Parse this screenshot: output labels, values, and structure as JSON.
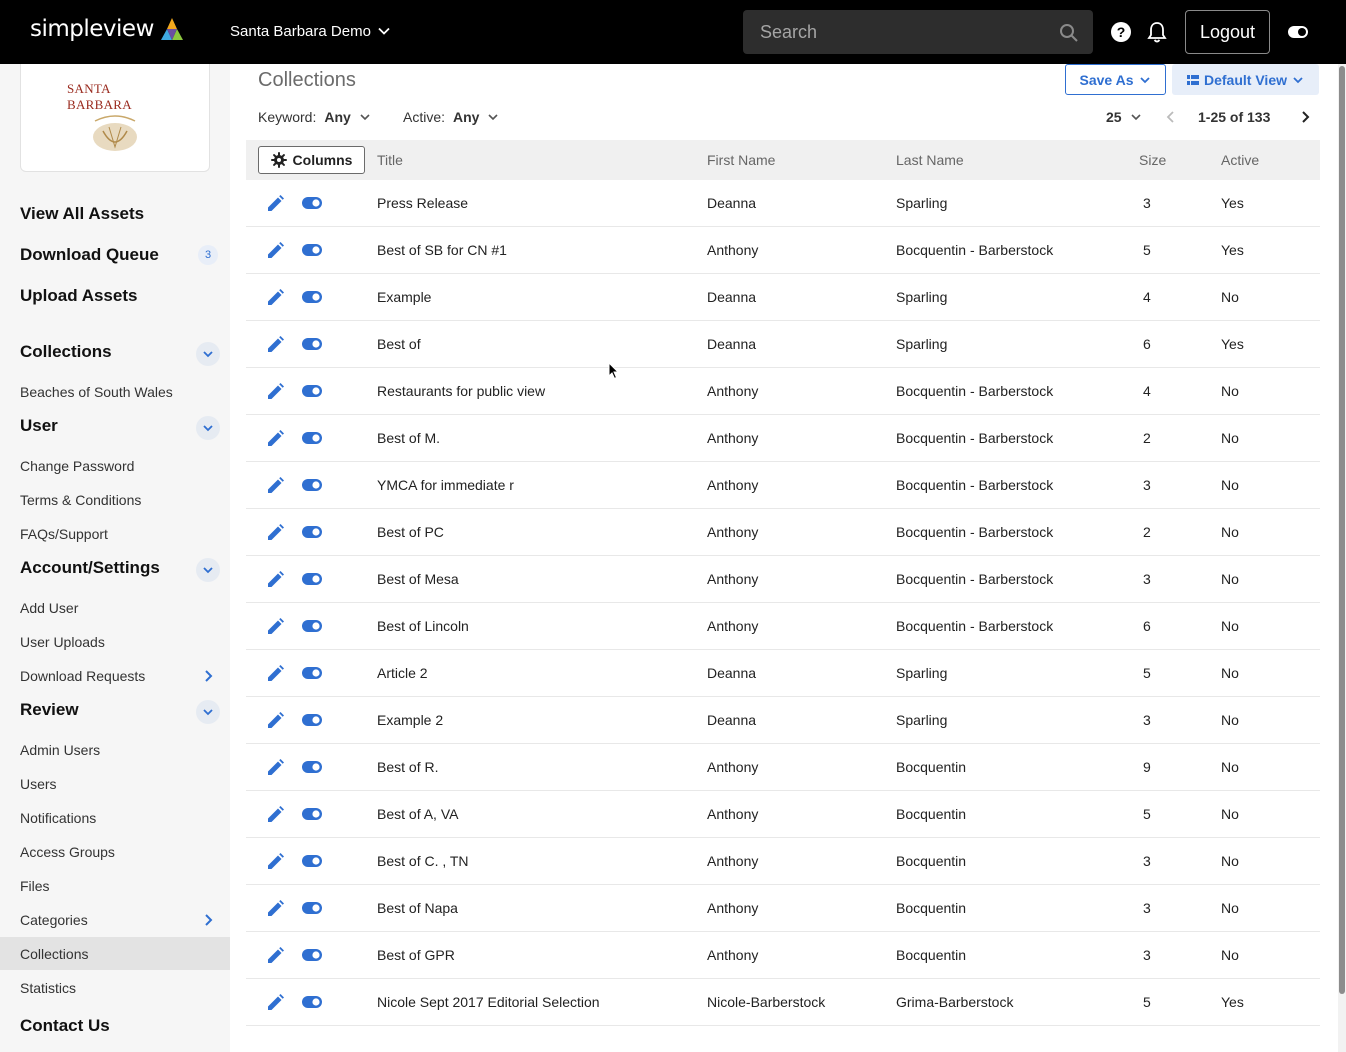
{
  "header": {
    "logo_text": "simpleview",
    "site_name": "Santa Barbara Demo",
    "search_placeholder": "Search",
    "logout_label": "Logout"
  },
  "sidebar": {
    "brand_text": "SANTA BARBARA",
    "main_links": [
      {
        "label": "View All Assets"
      },
      {
        "label": "Download Queue",
        "badge": "3"
      },
      {
        "label": "Upload Assets"
      }
    ],
    "sections": [
      {
        "title": "Collections",
        "items": [
          "Beaches of South Wales"
        ]
      },
      {
        "title": "User",
        "items": [
          "Change Password",
          "Terms & Conditions",
          "FAQs/Support"
        ]
      },
      {
        "title": "Account/Settings",
        "items": [
          "Add User",
          "User Uploads",
          "Download Requests"
        ]
      },
      {
        "title": "Review",
        "items": [
          "Admin Users",
          "Users",
          "Notifications",
          "Access Groups",
          "Files",
          "Categories",
          "Collections",
          "Statistics"
        ]
      }
    ],
    "contact": "Contact Us",
    "active_item": "Collections"
  },
  "main": {
    "title": "Collections",
    "save_as_label": "Save As",
    "default_view_label": "Default View",
    "filters": [
      {
        "label": "Keyword:",
        "value": "Any"
      },
      {
        "label": "Active:",
        "value": "Any"
      }
    ],
    "page_size": "25",
    "range": "1-25 of 133",
    "columns_label": "Columns",
    "headers": [
      "Title",
      "First Name",
      "Last Name",
      "Size",
      "Active"
    ],
    "rows": [
      [
        "Press Release",
        "Deanna",
        "Sparling",
        "3",
        "Yes"
      ],
      [
        "Best of SB for CN #1",
        "Anthony",
        "Bocquentin - Barberstock",
        "5",
        "Yes"
      ],
      [
        "Example",
        "Deanna",
        "Sparling",
        "4",
        "No"
      ],
      [
        "Best of",
        "Deanna",
        "Sparling",
        "6",
        "Yes"
      ],
      [
        "Restaurants for public view",
        "Anthony",
        "Bocquentin - Barberstock",
        "4",
        "No"
      ],
      [
        "Best of M.",
        "Anthony",
        "Bocquentin - Barberstock",
        "2",
        "No"
      ],
      [
        "YMCA for immediate r",
        "Anthony",
        "Bocquentin - Barberstock",
        "3",
        "No"
      ],
      [
        "Best of PC",
        "Anthony",
        "Bocquentin - Barberstock",
        "2",
        "No"
      ],
      [
        "Best of Mesa",
        "Anthony",
        "Bocquentin - Barberstock",
        "3",
        "No"
      ],
      [
        "Best of Lincoln",
        "Anthony",
        "Bocquentin - Barberstock",
        "6",
        "No"
      ],
      [
        "Article 2",
        "Deanna",
        "Sparling",
        "5",
        "No"
      ],
      [
        "Example 2",
        "Deanna",
        "Sparling",
        "3",
        "No"
      ],
      [
        "Best of R.",
        "Anthony",
        "Bocquentin",
        "9",
        "No"
      ],
      [
        "Best of A, VA",
        "Anthony",
        "Bocquentin",
        "5",
        "No"
      ],
      [
        "Best of C. , TN",
        "Anthony",
        "Bocquentin",
        "3",
        "No"
      ],
      [
        "Best of Napa",
        "Anthony",
        "Bocquentin",
        "3",
        "No"
      ],
      [
        "Best of GPR",
        "Anthony",
        "Bocquentin",
        "3",
        "No"
      ],
      [
        "Nicole Sept 2017 Editorial Selection",
        "Nicole-Barberstock",
        "Grima-Barberstock",
        "5",
        "Yes"
      ]
    ]
  },
  "colors": {
    "accent": "#2f6fd1",
    "topbar": "#000000",
    "sidebar_bg": "#f6f6f6"
  },
  "icons": [
    "search-icon",
    "help-icon",
    "bell-icon",
    "theme-toggle-icon",
    "chevron-down-icon",
    "gear-icon",
    "edit-pencil-icon",
    "toggle-icon",
    "chevron-right-icon",
    "chevron-left-icon",
    "grid-icon"
  ]
}
